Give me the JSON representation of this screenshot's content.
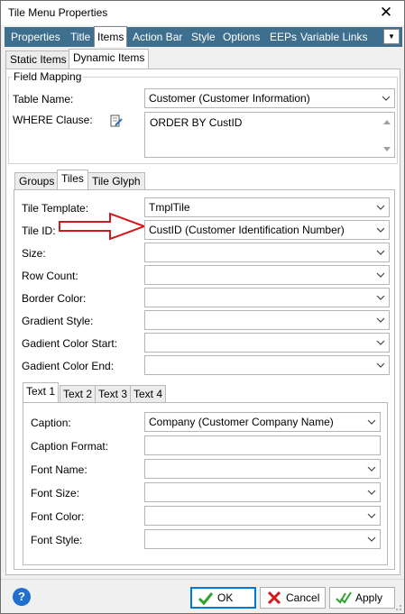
{
  "window": {
    "title": "Tile Menu Properties"
  },
  "main_tabs": [
    "Properties",
    "Title",
    "Items",
    "Action Bar",
    "Style",
    "Options",
    "EEPs",
    "Variable Links"
  ],
  "sub_tabs": [
    "Static Items",
    "Dynamic Items"
  ],
  "field_mapping": {
    "legend": "Field Mapping",
    "table_name_label": "Table Name:",
    "table_name_value": "Customer  (Customer Information)",
    "where_label": "WHERE Clause:",
    "where_value": "ORDER BY CustID"
  },
  "inner_tabs": [
    "Groups",
    "Tiles",
    "Tile Glyph"
  ],
  "tiles": {
    "rows": [
      {
        "label": "Tile Template:",
        "value": "TmplTile"
      },
      {
        "label": "Tile ID:",
        "value": "CustID  (Customer Identification Number)"
      },
      {
        "label": "Size:",
        "value": ""
      },
      {
        "label": "Row Count:",
        "value": ""
      },
      {
        "label": "Border Color:",
        "value": ""
      },
      {
        "label": "Gradient Style:",
        "value": ""
      },
      {
        "label": "Gadient Color Start:",
        "value": ""
      },
      {
        "label": "Gadient Color End:",
        "value": ""
      }
    ]
  },
  "text_tabs": [
    "Text 1",
    "Text 2",
    "Text 3",
    "Text 4"
  ],
  "text1": {
    "rows": [
      {
        "label": "Caption:",
        "value": "Company  (Customer Company Name)"
      },
      {
        "label": "Caption Format:",
        "value": ""
      },
      {
        "label": "Font Name:",
        "value": ""
      },
      {
        "label": "Font Size:",
        "value": ""
      },
      {
        "label": "Font Color:",
        "value": ""
      },
      {
        "label": "Font Style:",
        "value": ""
      }
    ]
  },
  "footer": {
    "help": "?",
    "ok_label": "OK",
    "cancel_label": "Cancel",
    "apply_label": "Apply"
  },
  "colors": {
    "tab_bar": "#3f6f8e",
    "arrow": "#d0181d",
    "ok_check": "#2aa52a",
    "cancel_x": "#d0181d",
    "help": "#1f6fd1"
  }
}
